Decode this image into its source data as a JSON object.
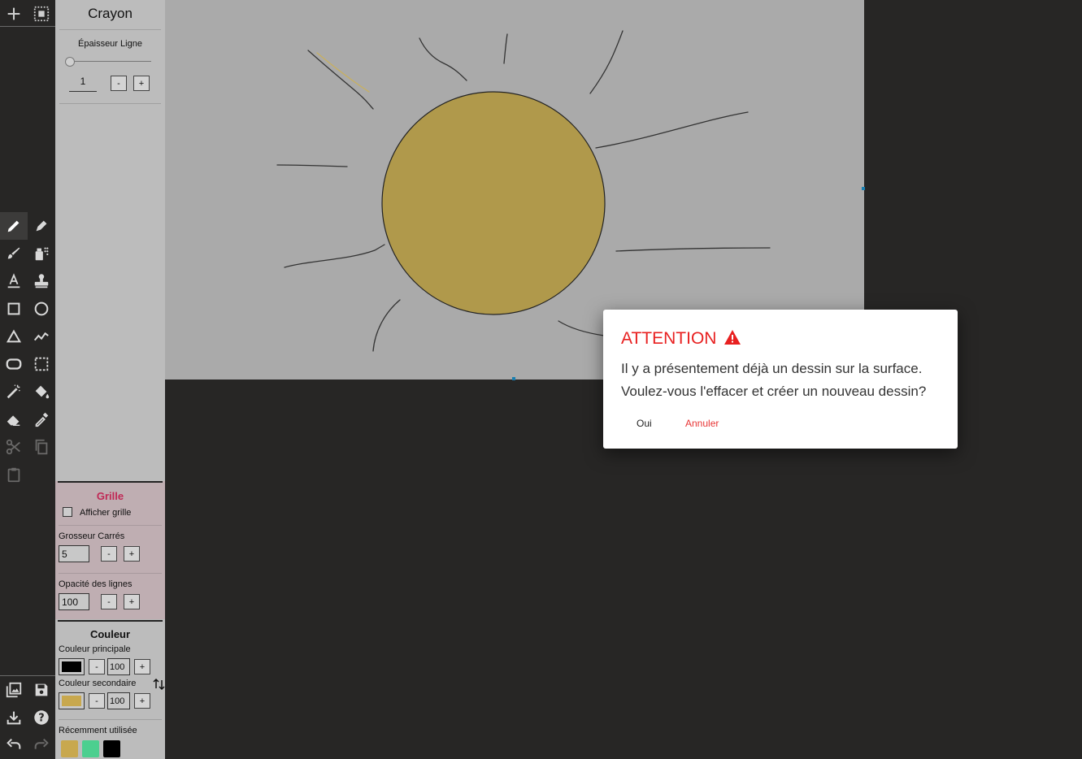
{
  "colors": {
    "accent_red": "#e82020",
    "grille_title": "#c02855",
    "sun_fill": "#b0994b",
    "primary_color": "#000000",
    "secondary_color": "#c8a84e"
  },
  "toolbar": {
    "top": [
      "add-icon",
      "select-all-icon"
    ],
    "tools": [
      "pencil-icon",
      "pen-icon",
      "brush-icon",
      "spray-icon",
      "text-icon",
      "stamp-icon",
      "rectangle-icon",
      "circle-icon",
      "triangle-icon",
      "polyline-icon",
      "rounded-rect-icon",
      "selection-icon",
      "magic-wand-icon",
      "fill-bucket-icon",
      "eraser-icon",
      "eyedropper-icon",
      "scissors-icon",
      "copy-icon",
      "paste-icon"
    ],
    "bottom": [
      "gallery-icon",
      "save-icon",
      "download-icon",
      "help-icon",
      "undo-icon",
      "redo-icon"
    ]
  },
  "panel": {
    "tool_title": "Crayon",
    "thickness_label": "Épaisseur Ligne",
    "thickness_value": "1",
    "minus": "-",
    "plus": "+",
    "grid": {
      "title": "Grille",
      "show_label": "Afficher grille",
      "show_checked": false,
      "size_label": "Grosseur Carrés",
      "size_value": "5",
      "opacity_label": "Opacité des lignes",
      "opacity_value": "100"
    },
    "color": {
      "title": "Couleur",
      "primary_label": "Couleur principale",
      "primary_value": "100",
      "secondary_label": "Couleur secondaire",
      "secondary_value": "100",
      "recent_label": "Récemment utilisée",
      "recent": [
        "#c8a84e",
        "#4ccf8f",
        "#000000"
      ]
    }
  },
  "dialog": {
    "title": "ATTENTION",
    "line1": "Il y a présentement déjà un dessin sur la surface.",
    "line2": "Voulez-vous l'effacer et créer un nouveau dessin?",
    "yes": "Oui",
    "cancel": "Annuler"
  }
}
